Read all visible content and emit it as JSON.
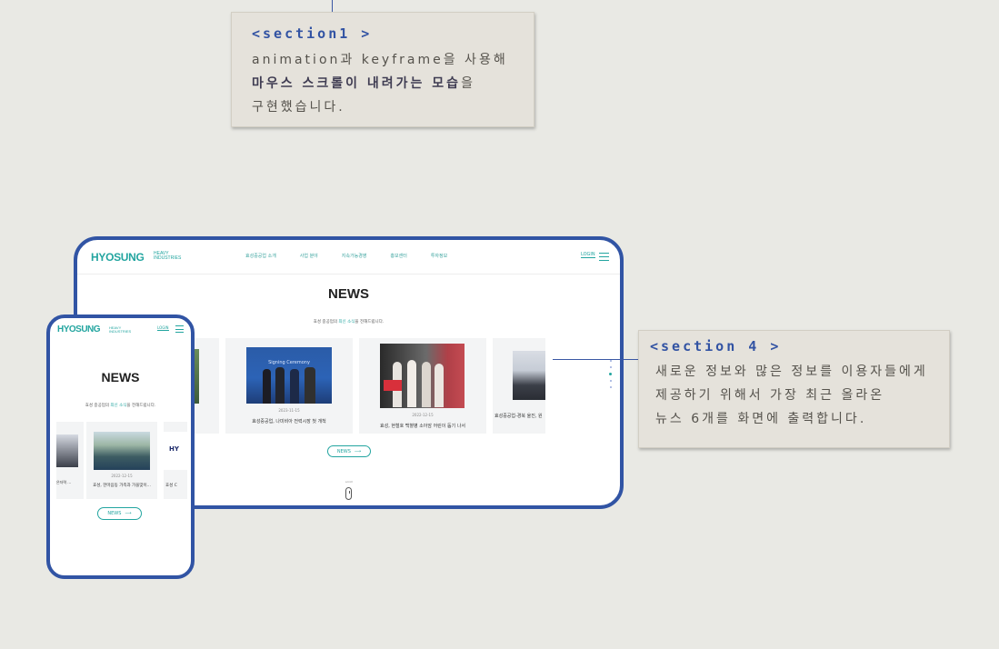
{
  "notes": [
    {
      "title": "<section1 >",
      "lines": [
        "animation과 keyframe을 사용해",
        "마우스 스크롤이 내려가는 모습을",
        "구현했습니다."
      ],
      "bold_text": "마우스 스크롤이 내려가는 모습",
      "bold_suffix": "을"
    },
    {
      "title": "<section 4 >",
      "lines": [
        "새로운 정보와 많은 정보를 이용자들에게",
        "제공하기 위해서 가장 최근 올라온",
        "뉴스 6개를 화면에 출력합니다."
      ]
    }
  ],
  "desktop": {
    "logo": "HYOSUNG",
    "logo_sub_1": "HEAVY",
    "logo_sub_2": "INDUSTRIES",
    "nav": [
      "효성중공업 소개",
      "사업 분야",
      "지속가능경영",
      "홍보센터",
      "투자정보"
    ],
    "login": "LOGIN",
    "title": "NEWS",
    "subtitle_pre": "효성 중공업의 ",
    "subtitle_hl": "최신 소식",
    "subtitle_post": "을 전해드립니다.",
    "cards": [
      {
        "date": "2023-11-15",
        "caption": "효성중공업, 나미비아 전력시장 첫 개척",
        "thumb_text": "Signing Ceremony"
      },
      {
        "date": "2022-12-15",
        "caption": "효성, 현철호 백혈병 소아암 어린이 돕기 나서"
      },
      {
        "date": "",
        "caption": "효성중공업-경북 울진, 원"
      }
    ],
    "more": "NEWS",
    "scroll": "scroll"
  },
  "mobile": {
    "logo": "HYOSUNG",
    "logo_sub_1": "HEAVY",
    "logo_sub_2": "INDUSTRIES",
    "login": "LOGIN",
    "title": "NEWS",
    "subtitle_pre": "효성 중공업의 ",
    "subtitle_hl": "최신 소식",
    "subtitle_post": "을 전해드립니다.",
    "cards": [
      {
        "date": "",
        "caption": "은자력 ..."
      },
      {
        "date": "2022-12-15",
        "caption": "효성, 한마음동 가족과 가을맞이..."
      },
      {
        "date": "",
        "caption": "효성 C",
        "thumb_text": "HY"
      }
    ],
    "more": "NEWS"
  },
  "colors": {
    "frame": "#3154a4",
    "accent": "#23a5a0",
    "note_bg": "#e5e2db",
    "page_bg": "#e9e9e4"
  },
  "icons": [
    "menu-icon",
    "arrow-right-icon",
    "mouse-scroll-icon",
    "section-dots-icon"
  ]
}
